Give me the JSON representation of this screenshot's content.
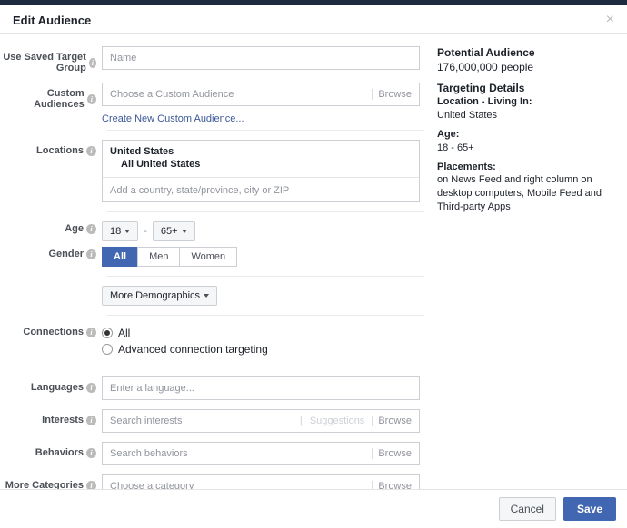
{
  "title": "Edit Audience",
  "labels": {
    "useSavedTargetGroup": "Use Saved Target Group",
    "customAudiences": "Custom Audiences",
    "locations": "Locations",
    "age": "Age",
    "gender": "Gender",
    "connections": "Connections",
    "languages": "Languages",
    "interests": "Interests",
    "behaviors": "Behaviors",
    "moreCategories": "More Categories"
  },
  "placeholders": {
    "name": "Name",
    "customAudience": "Choose a Custom Audience",
    "locationAdd": "Add a country, state/province, city or ZIP",
    "language": "Enter a language...",
    "interests": "Search interests",
    "behaviors": "Search behaviors",
    "category": "Choose a category"
  },
  "links": {
    "createCustomAudience": "Create New Custom Audience...",
    "browse": "Browse",
    "suggestions": "Suggestions"
  },
  "locations": {
    "selected": "United States",
    "sub": "All United States"
  },
  "age": {
    "min": "18",
    "max": "65+"
  },
  "gender": {
    "options": [
      "All",
      "Men",
      "Women"
    ],
    "selected": "All"
  },
  "moreDemographics": "More Demographics",
  "connections": {
    "all": "All",
    "advanced": "Advanced connection targeting",
    "selected": "all"
  },
  "sidebar": {
    "potentialTitle": "Potential Audience",
    "potentialValue": "176,000,000 people",
    "targetingTitle": "Targeting Details",
    "locationLabel": "Location - Living In:",
    "locationValue": "United States",
    "ageLabel": "Age:",
    "ageValue": "18 - 65+",
    "placementsLabel": "Placements:",
    "placementsValue": "on News Feed and right column on desktop computers, Mobile Feed and Third-party Apps"
  },
  "footer": {
    "cancel": "Cancel",
    "save": "Save"
  }
}
